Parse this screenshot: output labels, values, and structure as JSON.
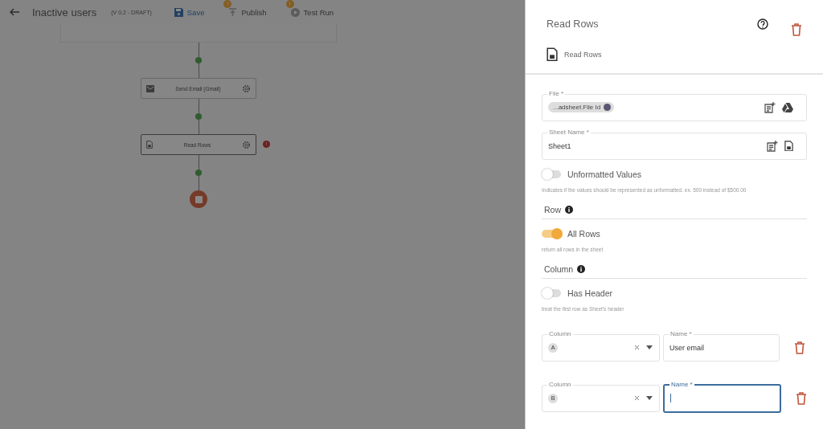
{
  "header": {
    "title": "Inactive users",
    "version": "(V 0.2 - DRAFT)",
    "actions": [
      {
        "label": "Save",
        "kind": "save",
        "disabled": false
      },
      {
        "label": "Publish",
        "kind": "publish",
        "disabled": true,
        "badge": "!"
      },
      {
        "label": "Test Run",
        "kind": "run",
        "disabled": true,
        "badge": "!"
      }
    ]
  },
  "flow": {
    "nodes": [
      {
        "label": "Send Email (Gmail)",
        "kind": "mail",
        "error": false
      },
      {
        "label": "Read Rows",
        "kind": "sheet",
        "error": true,
        "error_badge": "!"
      }
    ]
  },
  "panel": {
    "title": "Read Rows",
    "action": "Read Rows",
    "file": {
      "label": "File *",
      "chip": "...adsheet.File Id"
    },
    "sheet": {
      "label": "Sheet Name *",
      "value": "Sheet1"
    },
    "unformatted": {
      "label": "Unformatted Values",
      "on": false,
      "hint": "Indicates if the values should be represented as unformatted. ex. 500 instead of $500.00"
    },
    "row_section": "Row",
    "all_rows": {
      "label": "All Rows",
      "on": true,
      "hint": "return all rows in the sheet"
    },
    "column_section": "Column",
    "has_header": {
      "label": "Has Header",
      "on": false,
      "hint": "treat the first row as Sheet's header"
    },
    "mappings": [
      {
        "column_label": "Column",
        "column": "A",
        "name_label": "Name *",
        "name": "User email",
        "focused": false
      },
      {
        "column_label": "Column",
        "column": "B",
        "name_label": "Name *",
        "focused": true
      }
    ]
  }
}
